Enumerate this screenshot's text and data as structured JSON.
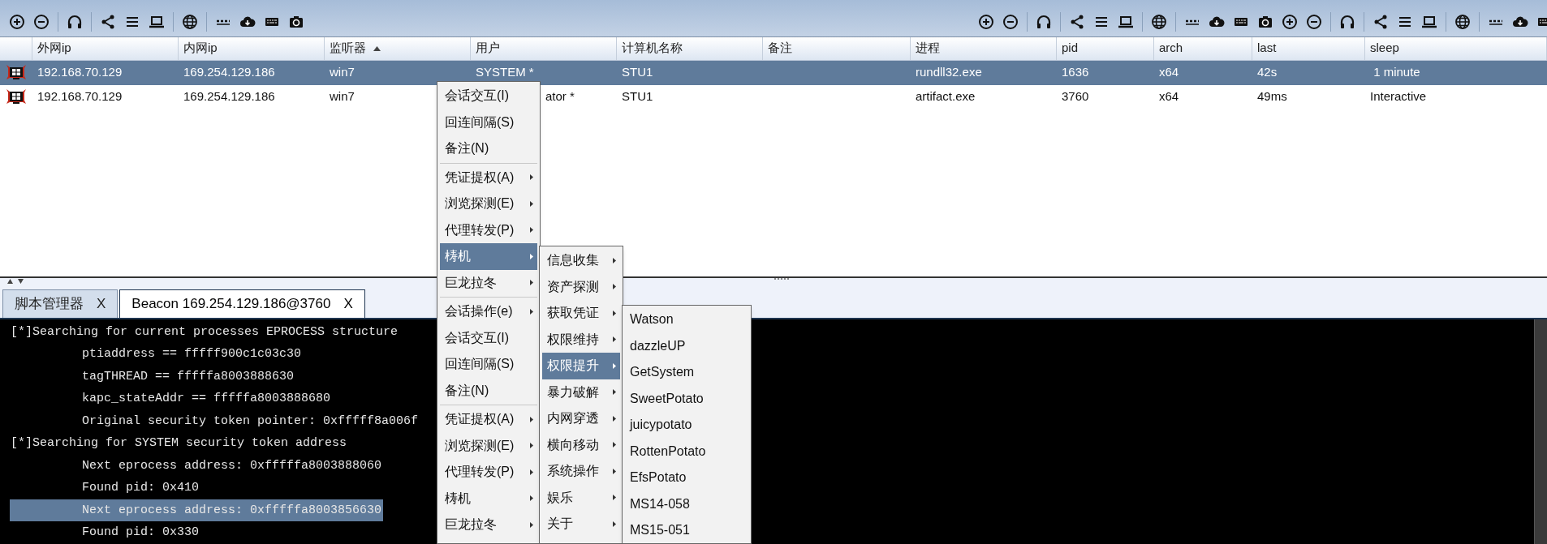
{
  "sessions_table": {
    "columns": [
      {
        "label": "外网ip",
        "sorted": false
      },
      {
        "label": "内网ip",
        "sorted": false
      },
      {
        "label": "监听器",
        "sorted": true
      },
      {
        "label": "用户",
        "sorted": false
      },
      {
        "label": "计算机名称",
        "sorted": false
      },
      {
        "label": "备注",
        "sorted": false
      },
      {
        "label": "进程",
        "sorted": false
      },
      {
        "label": "pid",
        "sorted": false
      },
      {
        "label": "arch",
        "sorted": false
      },
      {
        "label": "last",
        "sorted": false
      },
      {
        "label": "sleep",
        "sorted": false
      }
    ],
    "rows": [
      {
        "selected": true,
        "cells": [
          "192.168.70.129",
          "169.254.129.186",
          "win7",
          "SYSTEM *",
          "STU1",
          "",
          "rundll32.exe",
          "1636",
          "x64",
          "42s",
          " 1 minute"
        ]
      },
      {
        "selected": false,
        "cells": [
          "192.168.70.129",
          "169.254.129.186",
          "win7",
          "ator *",
          "STU1",
          "",
          "artifact.exe",
          "3760",
          "x64",
          "49ms",
          "Interactive"
        ]
      }
    ]
  },
  "tabs": [
    {
      "label": "脚本管理器",
      "close": "X",
      "selected": false
    },
    {
      "label": "Beacon 169.254.129.186@3760",
      "close": "X",
      "selected": true
    }
  ],
  "console": {
    "lines": [
      {
        "kind": "header",
        "text": "[*]Searching for current processes EPROCESS structure",
        "selected": false
      },
      {
        "kind": "detail",
        "text": "ptiaddress == fffff900c1c03c30",
        "selected": false
      },
      {
        "kind": "detail",
        "text": "tagTHREAD == fffffa8003888630",
        "selected": false
      },
      {
        "kind": "detail",
        "text": "kapc_stateAddr == fffffa8003888680",
        "selected": false
      },
      {
        "kind": "detail",
        "text": "Original security token pointer: 0xfffff8a006f",
        "selected": false
      },
      {
        "kind": "header",
        "text": "[*]Searching for SYSTEM security token address",
        "selected": false
      },
      {
        "kind": "detail",
        "text": "Next eprocess address: 0xfffffa8003888060",
        "selected": false
      },
      {
        "kind": "detail",
        "text": "Found pid: 0x410",
        "selected": false
      },
      {
        "kind": "detail",
        "text": "Next eprocess address: 0xfffffa8003856630",
        "selected": true
      },
      {
        "kind": "detail",
        "text": "Found pid: 0x330",
        "selected": false
      }
    ]
  },
  "context_menus": [
    {
      "items": [
        {
          "kind": "item",
          "label": "会话交互(I)",
          "selected": false
        },
        {
          "kind": "item",
          "label": "回连间隔(S)",
          "selected": false
        },
        {
          "kind": "item",
          "label": "备注(N)",
          "selected": false
        },
        {
          "kind": "separator"
        },
        {
          "kind": "submenu",
          "label": "凭证提权(A)",
          "selected": false
        },
        {
          "kind": "submenu",
          "label": "浏览探测(E)",
          "selected": false
        },
        {
          "kind": "submenu",
          "label": "代理转发(P)",
          "selected": false
        },
        {
          "kind": "submenu",
          "label": "梼机",
          "selected": true
        },
        {
          "kind": "submenu",
          "label": "巨龙拉冬",
          "selected": false
        },
        {
          "kind": "separator"
        },
        {
          "kind": "submenu",
          "label": "会话操作(e)",
          "selected": false
        },
        {
          "kind": "item",
          "label": "会话交互(I)",
          "selected": false
        },
        {
          "kind": "item",
          "label": "回连间隔(S)",
          "selected": false
        },
        {
          "kind": "item",
          "label": "备注(N)",
          "selected": false
        },
        {
          "kind": "separator"
        },
        {
          "kind": "submenu",
          "label": "凭证提权(A)",
          "selected": false
        },
        {
          "kind": "submenu",
          "label": "浏览探测(E)",
          "selected": false
        },
        {
          "kind": "submenu",
          "label": "代理转发(P)",
          "selected": false
        },
        {
          "kind": "submenu",
          "label": "梼机",
          "selected": false
        },
        {
          "kind": "submenu",
          "label": "巨龙拉冬",
          "selected": false
        }
      ]
    },
    {
      "items": [
        {
          "kind": "submenu",
          "label": "信息收集",
          "selected": false
        },
        {
          "kind": "submenu",
          "label": "资产探测",
          "selected": false
        },
        {
          "kind": "submenu",
          "label": "获取凭证",
          "selected": false
        },
        {
          "kind": "submenu",
          "label": "权限维持",
          "selected": false
        },
        {
          "kind": "submenu",
          "label": "权限提升",
          "selected": true
        },
        {
          "kind": "submenu",
          "label": "暴力破解",
          "selected": false
        },
        {
          "kind": "submenu",
          "label": "内网穿透",
          "selected": false
        },
        {
          "kind": "submenu",
          "label": "横向移动",
          "selected": false
        },
        {
          "kind": "submenu",
          "label": "系统操作",
          "selected": false
        },
        {
          "kind": "submenu",
          "label": "娱乐",
          "selected": false
        },
        {
          "kind": "submenu",
          "label": "关于",
          "selected": false
        }
      ]
    },
    {
      "items": [
        {
          "kind": "item",
          "label": "Watson",
          "selected": false
        },
        {
          "kind": "item",
          "label": "dazzleUP",
          "selected": false
        },
        {
          "kind": "item",
          "label": "GetSystem",
          "selected": false
        },
        {
          "kind": "item",
          "label": "SweetPotato",
          "selected": false
        },
        {
          "kind": "item",
          "label": "juicypotato",
          "selected": false
        },
        {
          "kind": "item",
          "label": "RottenPotato",
          "selected": false
        },
        {
          "kind": "item",
          "label": "EfsPotato",
          "selected": false
        },
        {
          "kind": "item",
          "label": "MS14-058",
          "selected": false
        },
        {
          "kind": "item",
          "label": "MS15-051",
          "selected": false
        }
      ]
    }
  ]
}
